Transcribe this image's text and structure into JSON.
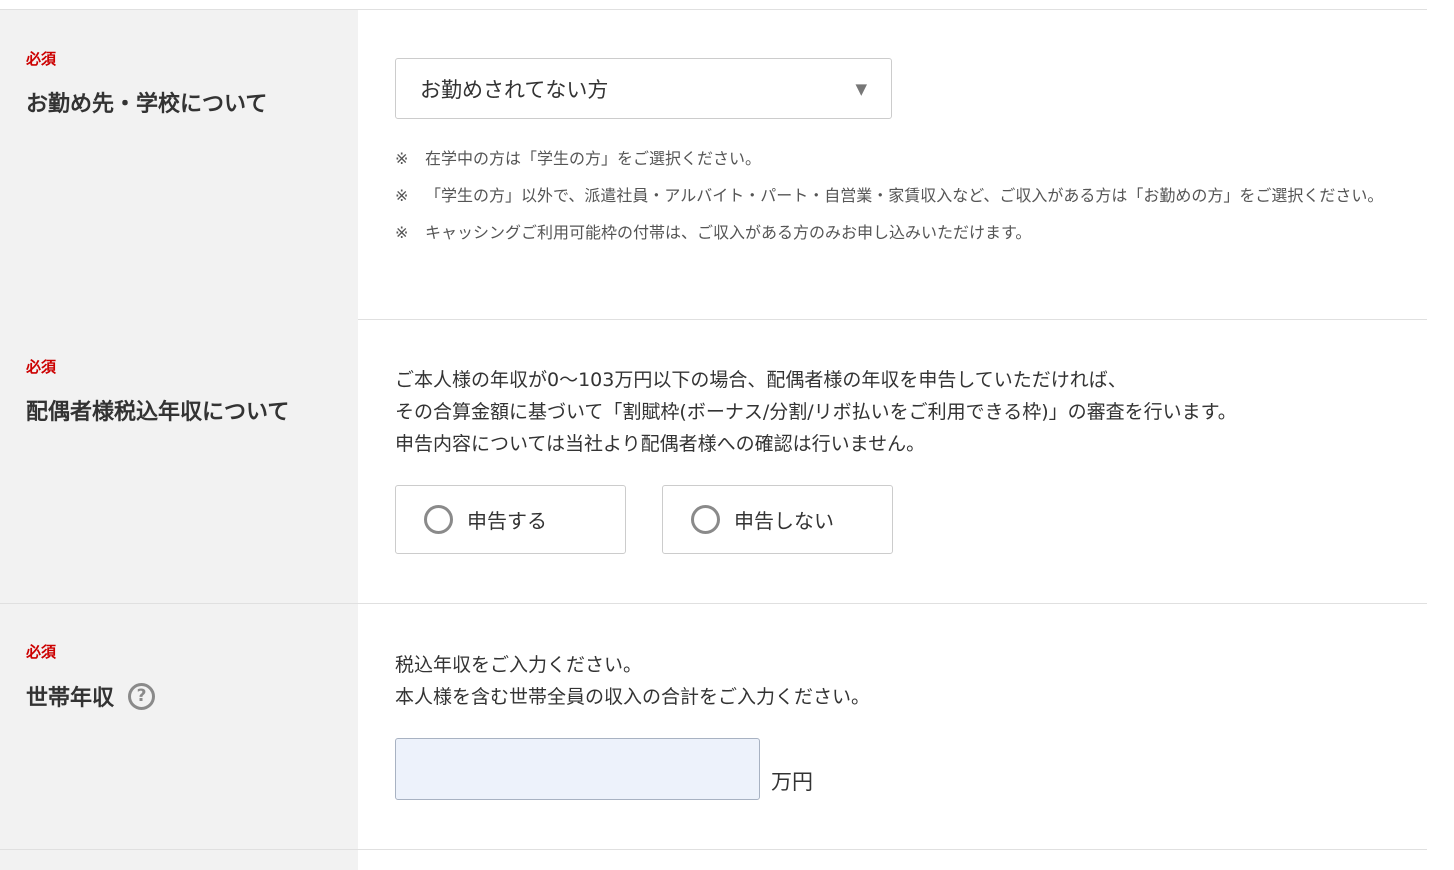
{
  "sections": [
    {
      "required": "必須",
      "title": "お勤め先・学校について",
      "select_value": "お勤めされてない方",
      "select_chevron": "▼",
      "notes": [
        {
          "mark": "※",
          "text": "在学中の方は「学生の方」をご選択ください。"
        },
        {
          "mark": "※",
          "text": "「学生の方」以外で、派遣社員・アルバイト・パート・自営業・家賃収入など、ご収入がある方は「お勤めの方」をご選択ください。"
        },
        {
          "mark": "※",
          "text": "キャッシングご利用可能枠の付帯は、ご収入がある方のみお申し込みいただけます。"
        }
      ]
    },
    {
      "required": "必須",
      "title": "配偶者様税込年収について",
      "description": [
        "ご本人様の年収が0〜103万円以下の場合、配偶者様の年収を申告していただければ、",
        "その合算金額に基づいて「割賦枠(ボーナス/分割/リボ払いをご利用できる枠)」の審査を行います。",
        "申告内容については当社より配偶者様への確認は行いません。"
      ],
      "options": [
        "申告する",
        "申告しない"
      ]
    },
    {
      "required": "必須",
      "title": "世帯年収",
      "help_icon": "question-circle-icon",
      "help_glyph": "?",
      "description": [
        "税込年収をご入力ください。",
        "本人様を含む世帯全員の収入の合計をご入力ください。"
      ],
      "input_value": "",
      "unit": "万円"
    }
  ]
}
